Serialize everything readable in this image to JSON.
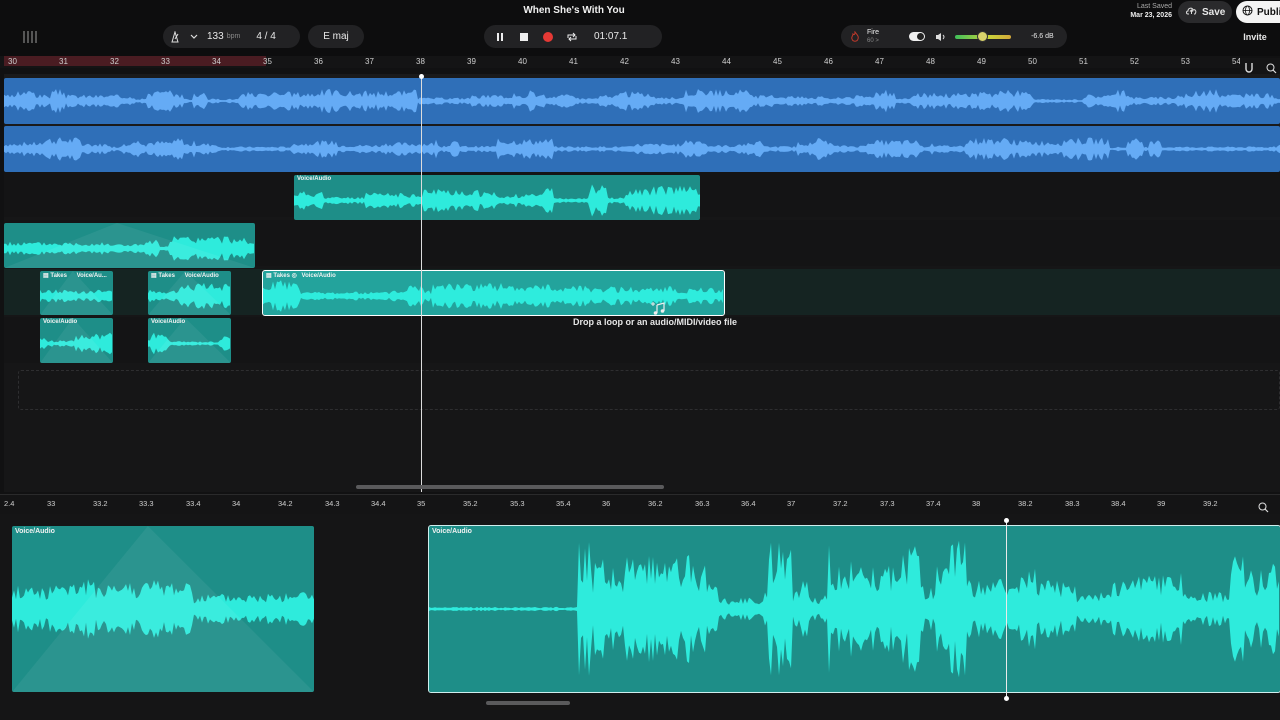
{
  "app": {
    "song_title": "When She's With You",
    "tempo": "133",
    "tempo_unit": "bpm",
    "time_signature": "4 / 4",
    "key": "E maj",
    "time_display": "01:07.1",
    "instrument_name": "Fire",
    "instrument_sub": "60 >",
    "volume_db": "-6.6 dB",
    "last_saved_label": "Last Saved",
    "last_saved_date": "Mar 23, 2026",
    "save_label": "Save",
    "publish_label": "Publi",
    "invite_label": "Invite"
  },
  "ruler": {
    "bars": [
      "30",
      "31",
      "32",
      "33",
      "34",
      "35",
      "36",
      "37",
      "38",
      "39",
      "40",
      "41",
      "42",
      "43",
      "44",
      "45",
      "46",
      "47",
      "48",
      "49",
      "50",
      "51",
      "52",
      "53",
      "54"
    ]
  },
  "tracks": {
    "clip_voice_label": "Voice/Audio",
    "takes_label": "Takes",
    "takes_voice_short": "Voice/Au...",
    "drop_text": "Drop a loop or an audio/MIDI/video file"
  },
  "editor": {
    "ruler_ticks": [
      "2.4",
      "33",
      "33.2",
      "33.3",
      "33.4",
      "34",
      "34.2",
      "34.3",
      "34.4",
      "35",
      "35.2",
      "35.3",
      "35.4",
      "36",
      "36.2",
      "36.3",
      "36.4",
      "37",
      "37.2",
      "37.3",
      "37.4",
      "38",
      "38.2",
      "38.3",
      "38.4",
      "39",
      "39.2"
    ],
    "clip_left_label": "Voice/Audio",
    "clip_right_label": "Voice/Audio"
  },
  "colors": {
    "blue_clip": "#2f6fb8",
    "teal_clip": "#1e8e88",
    "wave_teal": "#22e6d6",
    "record": "#e53935"
  }
}
